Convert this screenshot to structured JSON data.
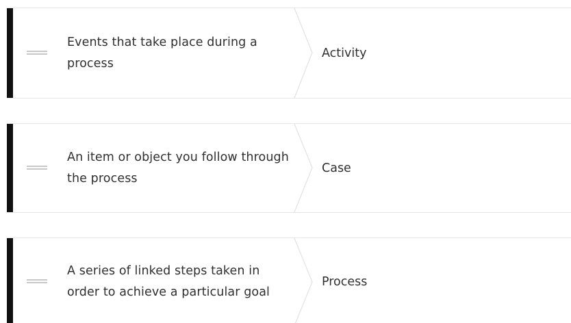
{
  "pairs": [
    {
      "definition": "Events that take place during a process",
      "term": "Activity"
    },
    {
      "definition": "An item or object you follow through the process",
      "term": "Case"
    },
    {
      "definition": "A series of linked steps taken in order to achieve a particular goal",
      "term": "Process"
    }
  ],
  "icons": {
    "handle": "drag-handle-icon",
    "separator": "chevron-divider"
  },
  "colors": {
    "accent": "#111111",
    "border": "#e6e6e6",
    "handle": "#c7c7c7",
    "text": "#2f2f2f"
  }
}
